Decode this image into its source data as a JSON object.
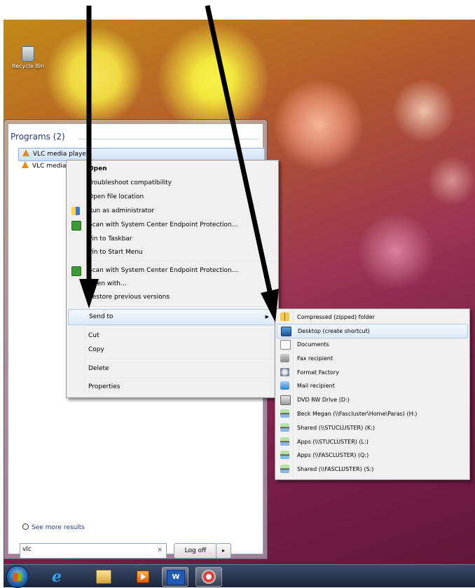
{
  "desktop": {
    "recycle_bin_label": "Recycle Bin"
  },
  "start_menu": {
    "programs_header": "Programs (2)",
    "programs": [
      {
        "label": "VLC media player",
        "icon": "vlc-icon"
      },
      {
        "label": "VLC media player",
        "icon": "vlc-icon"
      }
    ],
    "see_more": "See more results",
    "search_value": "vlc",
    "search_clear": "×",
    "logoff_label": "Log off",
    "logoff_arrow": "▸"
  },
  "context_menu": {
    "items": [
      {
        "label": "Open",
        "bold": true
      },
      {
        "label": "Troubleshoot compatibility"
      },
      {
        "label": "Open file location"
      },
      {
        "label": "Run as administrator",
        "icon": "shield-icon"
      },
      {
        "label": "Scan with System Center Endpoint Protection...",
        "icon": "scep-icon"
      },
      {
        "label": "Pin to Taskbar"
      },
      {
        "label": "Pin to Start Menu"
      },
      {
        "label": "Scan with System Center Endpoint Protection...",
        "icon": "scep-icon"
      },
      {
        "label": "Open with..."
      },
      {
        "label": "Restore previous versions"
      },
      {
        "label": "Send to",
        "submenu_arrow": "▶"
      },
      {
        "label": "Cut"
      },
      {
        "label": "Copy"
      },
      {
        "label": "Delete"
      },
      {
        "label": "Properties"
      }
    ]
  },
  "send_to_menu": {
    "items": [
      {
        "label": "Compressed (zipped) folder",
        "icon": "zip-folder-icon"
      },
      {
        "label": "Desktop (create shortcut)",
        "icon": "desktop-icon"
      },
      {
        "label": "Documents",
        "icon": "documents-icon"
      },
      {
        "label": "Fax recipient",
        "icon": "fax-icon"
      },
      {
        "label": "Format Factory",
        "icon": "format-factory-icon"
      },
      {
        "label": "Mail recipient",
        "icon": "mail-icon"
      },
      {
        "label": "DVD RW Drive (D:)",
        "icon": "dvd-drive-icon"
      },
      {
        "label": "Beck Megan (\\\\Fascluster\\Home\\Paras) (H:)",
        "icon": "network-drive-icon"
      },
      {
        "label": "Shared (\\\\STUCLUSTER) (K:)",
        "icon": "network-drive-icon"
      },
      {
        "label": "Apps (\\\\STUCLUSTER) (L:)",
        "icon": "network-drive-icon"
      },
      {
        "label": "Apps (\\\\FASCLUSTER) (Q:)",
        "icon": "network-drive-icon"
      },
      {
        "label": "Shared (\\\\FASCLUSTER) (S:)",
        "icon": "network-drive-icon"
      }
    ]
  },
  "taskbar": {
    "items": [
      {
        "icon": "start-orb-icon"
      },
      {
        "icon": "internet-explorer-icon",
        "glyph": "e"
      },
      {
        "icon": "file-explorer-icon"
      },
      {
        "icon": "media-player-icon"
      },
      {
        "icon": "word-icon",
        "glyph": "W"
      },
      {
        "icon": "snipping-tool-icon"
      }
    ]
  },
  "colors": {
    "arrow": "#000000",
    "menu_highlight": "#dde9f7",
    "programs_header": "#1e3a8a"
  }
}
